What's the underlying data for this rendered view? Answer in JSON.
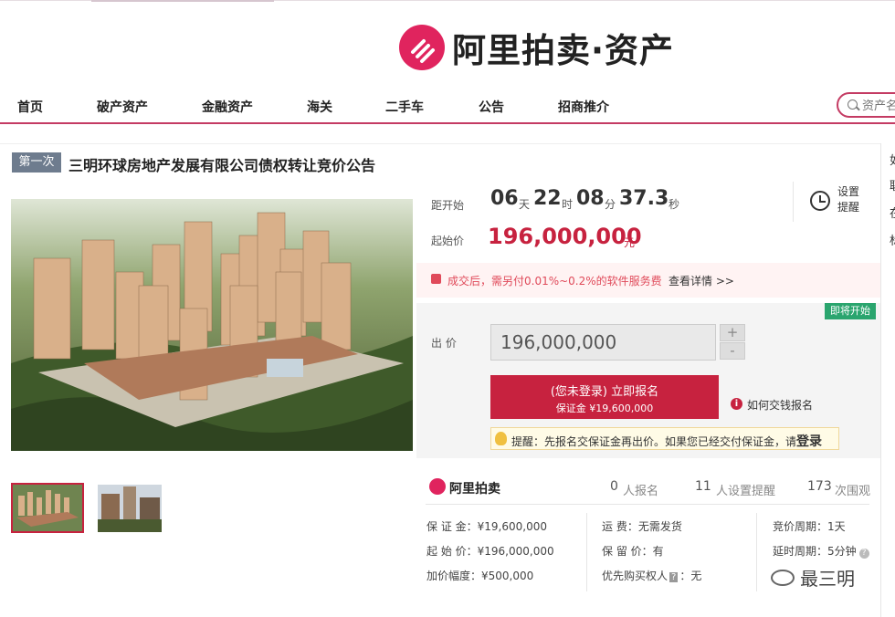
{
  "brand": {
    "name": "阿里拍卖·资产",
    "accent": "#e0245e"
  },
  "nav": {
    "items": [
      "首页",
      "破产资产",
      "金融资产",
      "海关",
      "二手车",
      "公告",
      "招商推介"
    ],
    "search_placeholder": "资产名"
  },
  "auction": {
    "round": "第一次",
    "title": "三明环球房地产发展有限公司债权转让竞价公告",
    "countdown_label": "距开始",
    "countdown": {
      "days": "06",
      "days_unit": "天",
      "hours": "22",
      "hours_unit": "时",
      "minutes": "08",
      "minutes_unit": "分",
      "seconds": "37.3",
      "seconds_unit": "秒"
    },
    "start_price_label": "起始价",
    "start_price": "196,000,000",
    "price_unit": "元",
    "remind_label": "设置提醒",
    "fee_notice": "成交后，需另付0.01%~0.2%的软件服务费",
    "fee_link": "查看详情 >>",
    "status_badge": "即将开始",
    "bid_label": "出  价",
    "bid_value": "196,000,000",
    "plus": "+",
    "minus": "-",
    "signup_line1": "(您未登录) 立即报名",
    "signup_line2": "保证金 ¥19,600,000",
    "how_to_label": "如何交钱报名",
    "tip_text": "提醒：先报名交保证金再出价。如果您已经交付保证金，请",
    "tip_login": "登录"
  },
  "stats": {
    "brand_small": "阿里拍卖",
    "signups": "0",
    "signups_label": "人报名",
    "reminders": "11",
    "reminders_label": "人设置提醒",
    "views": "173",
    "views_label": "次围观"
  },
  "details": {
    "deposit": "保 证 金：¥19,600,000",
    "start_price": "起 始 价：¥196,000,000",
    "increment": "加价幅度：¥500,000",
    "shipping": "运      费：无需发货",
    "reserve": "保 留 价：有",
    "priority": "优先购买权人",
    "priority_value": "：无",
    "priority_tag": "?",
    "cycle": "竞价周期：1天",
    "extension": "延时周期：5分钟"
  },
  "side": [
    "如",
    "联",
    "在",
    "标"
  ],
  "watermark": "最三明"
}
